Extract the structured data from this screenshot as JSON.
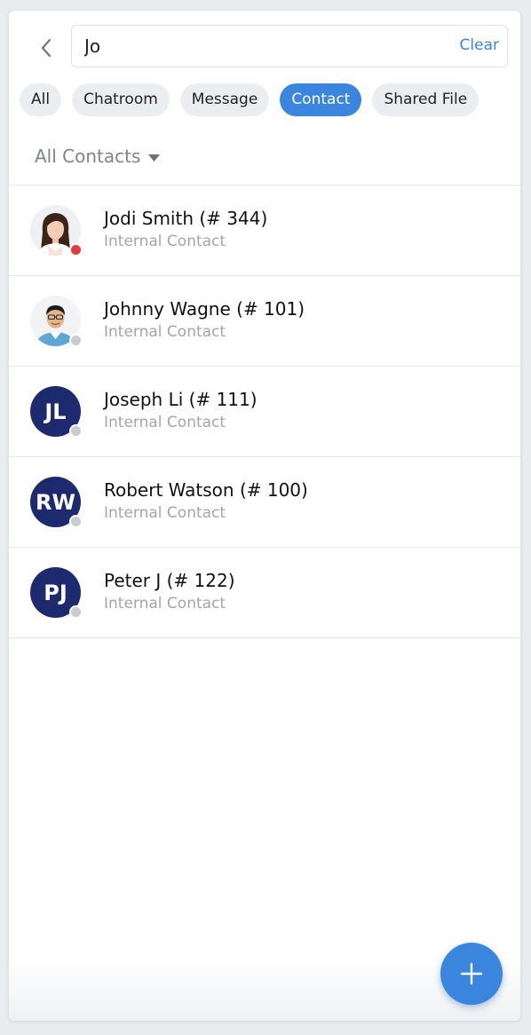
{
  "search": {
    "value": "Jo",
    "clear_label": "Clear"
  },
  "filters": [
    {
      "label": "All",
      "active": false
    },
    {
      "label": "Chatroom",
      "active": false
    },
    {
      "label": "Message",
      "active": false
    },
    {
      "label": "Contact",
      "active": true
    },
    {
      "label": "Shared File",
      "active": false
    }
  ],
  "scope": {
    "label": "All Contacts"
  },
  "contacts": [
    {
      "name": "Jodi Smith (# 344)",
      "subtitle": "Internal Contact",
      "avatar": "photo-woman",
      "initials": "",
      "status": "busy"
    },
    {
      "name": "Johnny Wagne (# 101)",
      "subtitle": "Internal Contact",
      "avatar": "photo-man",
      "initials": "",
      "status": "offline"
    },
    {
      "name": "Joseph Li (# 111)",
      "subtitle": "Internal Contact",
      "avatar": "initials",
      "initials": "JL",
      "status": "offline"
    },
    {
      "name": "Robert Watson (# 100)",
      "subtitle": "Internal Contact",
      "avatar": "initials",
      "initials": "RW",
      "status": "offline"
    },
    {
      "name": "Peter J (# 122)",
      "subtitle": "Internal Contact",
      "avatar": "initials",
      "initials": "PJ",
      "status": "offline"
    }
  ],
  "colors": {
    "accent": "#3a85de",
    "avatar_bg": "#1d2a6e",
    "busy": "#e8373e",
    "offline": "#c8ccd0"
  },
  "icons": {
    "back": "chevron-left-icon",
    "scope_caret": "caret-down-icon",
    "fab": "plus-icon"
  }
}
